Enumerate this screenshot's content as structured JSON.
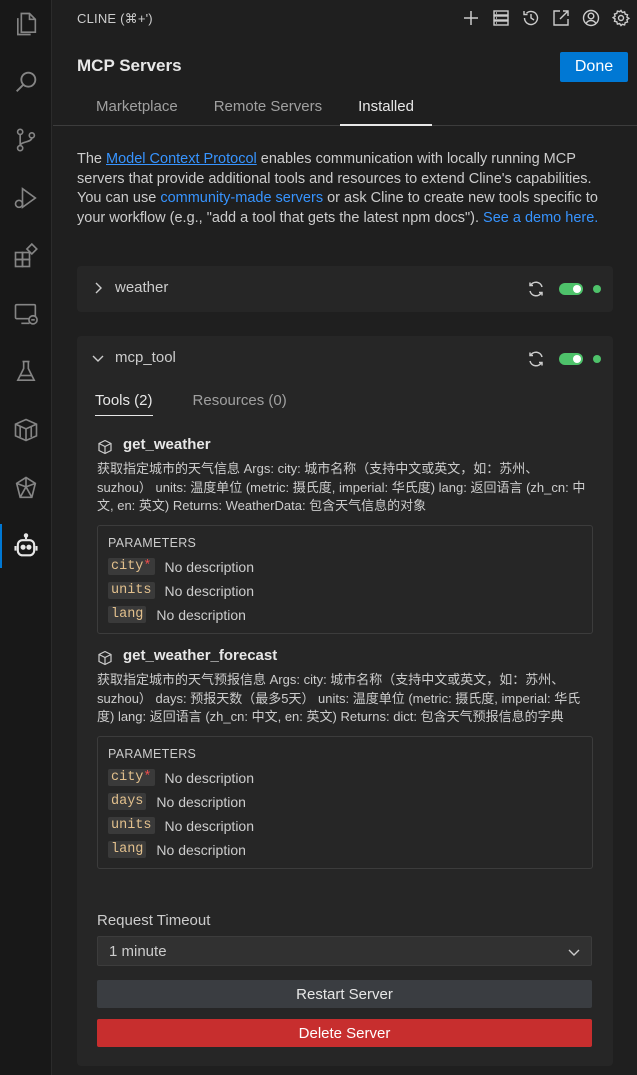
{
  "activity_bar": {
    "items": [
      "explorer-icon",
      "search-icon",
      "source-control-icon",
      "run-debug-icon",
      "extensions-icon",
      "remote-explorer-icon",
      "testing-icon",
      "containers-icon",
      "ai-assistant-icon",
      "cline-robot-icon"
    ],
    "active": "cline-robot-icon"
  },
  "titlebar": {
    "title": "CLINE (⌘+')",
    "icons": [
      "plus-icon",
      "mcp-servers-icon",
      "history-icon",
      "popout-icon",
      "account-icon",
      "settings-icon"
    ]
  },
  "header": {
    "title": "MCP Servers",
    "done_label": "Done",
    "tabs": [
      {
        "label": "Marketplace",
        "active": false
      },
      {
        "label": "Remote Servers",
        "active": false
      },
      {
        "label": "Installed",
        "active": true
      }
    ]
  },
  "intro": {
    "text1": "The ",
    "link1": "Model Context Protocol",
    "text2": " enables communication with locally running MCP servers that provide additional tools and resources to extend Cline's capabilities. You can use ",
    "link2": "community-made servers",
    "text3": " or ask Cline to create new tools specific to your workflow (e.g., \"add a tool that gets the latest npm docs\"). ",
    "link3": "See a demo here."
  },
  "servers": [
    {
      "name": "weather",
      "expanded": false,
      "enabled": true,
      "status_color": "#4ec26a"
    },
    {
      "name": "mcp_tool",
      "expanded": true,
      "enabled": true,
      "status_color": "#4ec26a",
      "subtabs": [
        {
          "label": "Tools (2)",
          "active": true
        },
        {
          "label": "Resources (0)",
          "active": false
        }
      ],
      "tools": [
        {
          "name": "get_weather",
          "description": "获取指定城市的天气信息 Args: city: 城市名称（支持中文或英文，如：苏州、suzhou） units: 温度单位 (metric: 摄氏度, imperial: 华氏度) lang: 返回语言 (zh_cn: 中文, en: 英文) Returns: WeatherData: 包含天气信息的对象",
          "params_title": "PARAMETERS",
          "params": [
            {
              "name": "city",
              "required": "*",
              "description": "No description"
            },
            {
              "name": "units",
              "required": "",
              "description": "No description"
            },
            {
              "name": "lang",
              "required": "",
              "description": "No description"
            }
          ]
        },
        {
          "name": "get_weather_forecast",
          "description": "获取指定城市的天气预报信息 Args: city: 城市名称（支持中文或英文，如：苏州、suzhou） days: 预报天数（最多5天） units: 温度单位 (metric: 摄氏度, imperial: 华氏度) lang: 返回语言 (zh_cn: 中文, en: 英文) Returns: dict: 包含天气预报信息的字典",
          "params_title": "PARAMETERS",
          "params": [
            {
              "name": "city",
              "required": "*",
              "description": "No description"
            },
            {
              "name": "days",
              "required": "",
              "description": "No description"
            },
            {
              "name": "units",
              "required": "",
              "description": "No description"
            },
            {
              "name": "lang",
              "required": "",
              "description": "No description"
            }
          ]
        }
      ],
      "timeout_label": "Request Timeout",
      "timeout_value": "1 minute",
      "restart_label": "Restart Server",
      "delete_label": "Delete Server"
    }
  ],
  "colors": {
    "accent": "#0078d4",
    "link": "#3794ff",
    "status_ok": "#4ec26a",
    "danger": "#c72e2e",
    "param": "#e2c08d"
  }
}
